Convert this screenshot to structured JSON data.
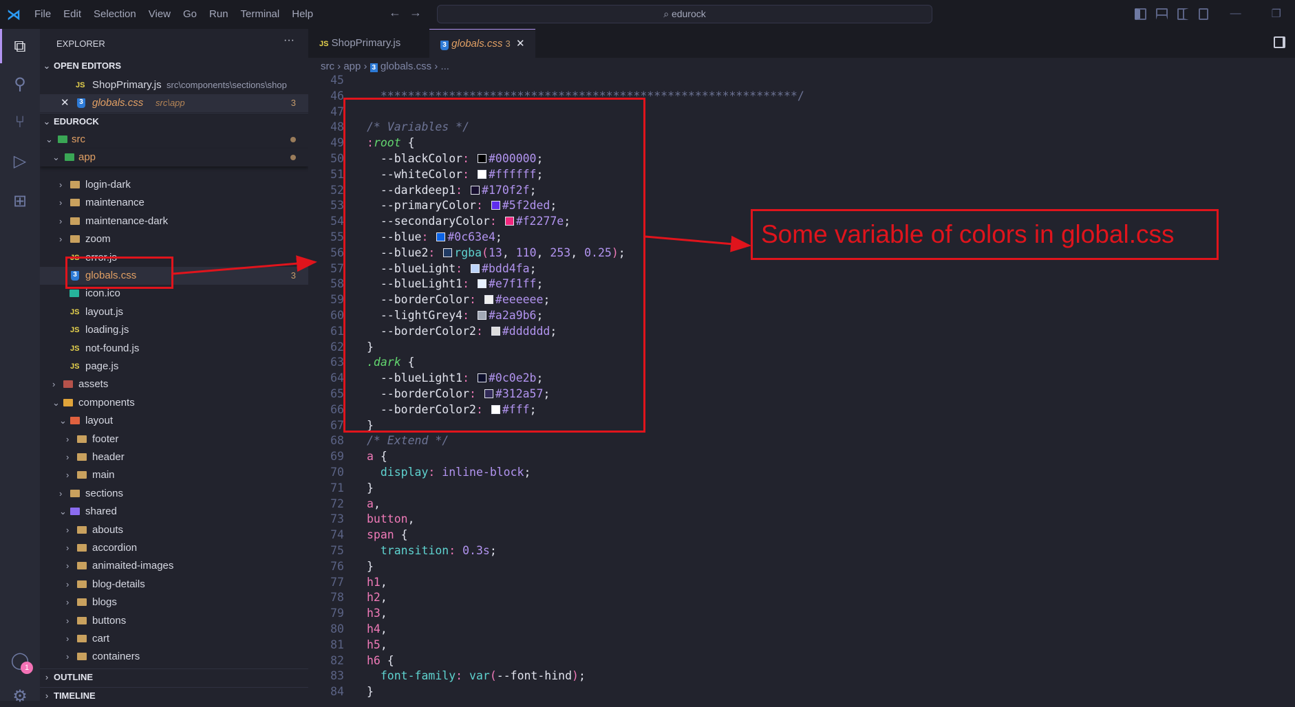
{
  "titlebar": {
    "menu": [
      "File",
      "Edit",
      "Selection",
      "View",
      "Go",
      "Run",
      "Terminal",
      "Help"
    ],
    "search": "edurock"
  },
  "explorer": {
    "title": "EXPLORER",
    "more": "···",
    "open_editors": "OPEN EDITORS",
    "project": "EDUROCK",
    "outline": "OUTLINE",
    "timeline": "TIMELINE",
    "open_files": [
      {
        "name": "ShopPrimary.js",
        "path": "src\\components\\sections\\shop",
        "type": "js"
      },
      {
        "name": "globals.css",
        "path": "src\\app",
        "type": "css",
        "count": "3",
        "close": "✕"
      }
    ],
    "src": "src",
    "app": "app",
    "tree": [
      {
        "label": "login-dark",
        "lvl": 2,
        "type": "folder"
      },
      {
        "label": "maintenance",
        "lvl": 2,
        "type": "folder"
      },
      {
        "label": "maintenance-dark",
        "lvl": 2,
        "type": "folder"
      },
      {
        "label": "zoom",
        "lvl": 2,
        "type": "folder"
      },
      {
        "label": "error.js",
        "lvl": 2,
        "type": "js"
      },
      {
        "label": "globals.css",
        "lvl": 2,
        "type": "css",
        "count": "3",
        "selected": true
      },
      {
        "label": "icon.ico",
        "lvl": 2,
        "type": "img"
      },
      {
        "label": "layout.js",
        "lvl": 2,
        "type": "js"
      },
      {
        "label": "loading.js",
        "lvl": 2,
        "type": "js"
      },
      {
        "label": "not-found.js",
        "lvl": 2,
        "type": "js"
      },
      {
        "label": "page.js",
        "lvl": 2,
        "type": "js"
      },
      {
        "label": "assets",
        "lvl": 1,
        "type": "folder-special",
        "color": "#b5524b"
      },
      {
        "label": "components",
        "lvl": 1,
        "type": "folder-open",
        "color": "#e0a43a"
      },
      {
        "label": "layout",
        "lvl": 2,
        "type": "folder-open",
        "color": "#e0613f"
      },
      {
        "label": "footer",
        "lvl": 3,
        "type": "folder"
      },
      {
        "label": "header",
        "lvl": 3,
        "type": "folder"
      },
      {
        "label": "main",
        "lvl": 3,
        "type": "folder"
      },
      {
        "label": "sections",
        "lvl": 2,
        "type": "folder"
      },
      {
        "label": "shared",
        "lvl": 2,
        "type": "folder-open",
        "color": "#8b6cf0"
      },
      {
        "label": "abouts",
        "lvl": 3,
        "type": "folder"
      },
      {
        "label": "accordion",
        "lvl": 3,
        "type": "folder"
      },
      {
        "label": "animaited-images",
        "lvl": 3,
        "type": "folder"
      },
      {
        "label": "blog-details",
        "lvl": 3,
        "type": "folder"
      },
      {
        "label": "blogs",
        "lvl": 3,
        "type": "folder"
      },
      {
        "label": "buttons",
        "lvl": 3,
        "type": "folder"
      },
      {
        "label": "cart",
        "lvl": 3,
        "type": "folder"
      },
      {
        "label": "containers",
        "lvl": 3,
        "type": "folder"
      }
    ]
  },
  "tabs": [
    {
      "label": "ShopPrimary.js",
      "type": "js"
    },
    {
      "label": "globals.css",
      "type": "css",
      "count": "3",
      "close": "✕",
      "active": true
    }
  ],
  "breadcrumb": [
    "src",
    "app",
    "globals.css",
    "..."
  ],
  "accounts_badge": "1",
  "code": [
    {
      "n": 45,
      "t": []
    },
    {
      "n": 46,
      "t": [
        [
          "stars",
          "  *************************************************************/"
        ]
      ]
    },
    {
      "n": 47,
      "t": []
    },
    {
      "n": 48,
      "t": [
        [
          "c",
          "/* Variables */"
        ]
      ]
    },
    {
      "n": 49,
      "t": [
        [
          "colon",
          ":"
        ],
        [
          "green",
          "root"
        ],
        [
          "punc",
          " {"
        ]
      ]
    },
    {
      "n": 50,
      "t": [
        [
          "prop",
          "  --blackColor"
        ],
        [
          "colon",
          ": "
        ],
        [
          "sw",
          "#000000"
        ],
        [
          "val",
          "#000000"
        ],
        [
          "punc",
          ";"
        ]
      ]
    },
    {
      "n": 51,
      "t": [
        [
          "prop",
          "  --whiteColor"
        ],
        [
          "colon",
          ": "
        ],
        [
          "sw",
          "#ffffff"
        ],
        [
          "val",
          "#ffffff"
        ],
        [
          "punc",
          ";"
        ]
      ]
    },
    {
      "n": 52,
      "t": [
        [
          "prop",
          "  --darkdeep1"
        ],
        [
          "colon",
          ": "
        ],
        [
          "sw",
          "#170f2f"
        ],
        [
          "val",
          "#170f2f"
        ],
        [
          "punc",
          ";"
        ]
      ]
    },
    {
      "n": 53,
      "t": [
        [
          "prop",
          "  --primaryColor"
        ],
        [
          "colon",
          ": "
        ],
        [
          "sw",
          "#5f2ded"
        ],
        [
          "val",
          "#5f2ded"
        ],
        [
          "punc",
          ";"
        ]
      ]
    },
    {
      "n": 54,
      "t": [
        [
          "prop",
          "  --secondaryColor"
        ],
        [
          "colon",
          ": "
        ],
        [
          "sw",
          "#f2277e"
        ],
        [
          "val",
          "#f2277e"
        ],
        [
          "punc",
          ";"
        ]
      ]
    },
    {
      "n": 55,
      "t": [
        [
          "prop",
          "  --blue"
        ],
        [
          "colon",
          ": "
        ],
        [
          "sw",
          "#0c63e4"
        ],
        [
          "val",
          "#0c63e4"
        ],
        [
          "punc",
          ";"
        ]
      ]
    },
    {
      "n": 56,
      "t": [
        [
          "prop",
          "  --blue2"
        ],
        [
          "colon",
          ": "
        ],
        [
          "sw",
          "#1f3a63"
        ],
        [
          "fn",
          "rgba"
        ],
        [
          "paren",
          "("
        ],
        [
          "val",
          "13"
        ],
        [
          "punc",
          ", "
        ],
        [
          "val",
          "110"
        ],
        [
          "punc",
          ", "
        ],
        [
          "val",
          "253"
        ],
        [
          "punc",
          ", "
        ],
        [
          "val",
          "0.25"
        ],
        [
          "paren",
          ")"
        ],
        [
          "punc",
          ";"
        ]
      ]
    },
    {
      "n": 57,
      "t": [
        [
          "prop",
          "  --blueLight"
        ],
        [
          "colon",
          ": "
        ],
        [
          "sw",
          "#bdd4fa"
        ],
        [
          "val",
          "#bdd4fa"
        ],
        [
          "punc",
          ";"
        ]
      ]
    },
    {
      "n": 58,
      "t": [
        [
          "prop",
          "  --blueLight1"
        ],
        [
          "colon",
          ": "
        ],
        [
          "sw",
          "#e7f1ff"
        ],
        [
          "val",
          "#e7f1ff"
        ],
        [
          "punc",
          ";"
        ]
      ]
    },
    {
      "n": 59,
      "t": [
        [
          "prop",
          "  --borderColor"
        ],
        [
          "colon",
          ": "
        ],
        [
          "sw",
          "#eeeeee"
        ],
        [
          "val",
          "#eeeeee"
        ],
        [
          "punc",
          ";"
        ]
      ]
    },
    {
      "n": 60,
      "t": [
        [
          "prop",
          "  --lightGrey4"
        ],
        [
          "colon",
          ": "
        ],
        [
          "sw",
          "#a2a9b6"
        ],
        [
          "val",
          "#a2a9b6"
        ],
        [
          "punc",
          ";"
        ]
      ]
    },
    {
      "n": 61,
      "t": [
        [
          "prop",
          "  --borderColor2"
        ],
        [
          "colon",
          ": "
        ],
        [
          "sw",
          "#dddddd"
        ],
        [
          "val",
          "#dddddd"
        ],
        [
          "punc",
          ";"
        ]
      ]
    },
    {
      "n": 62,
      "t": [
        [
          "punc",
          "}"
        ]
      ]
    },
    {
      "n": 63,
      "t": [
        [
          "green",
          ".dark"
        ],
        [
          "punc",
          " {"
        ]
      ]
    },
    {
      "n": 64,
      "t": [
        [
          "prop",
          "  --blueLight1"
        ],
        [
          "colon",
          ": "
        ],
        [
          "sw",
          "#0c0e2b"
        ],
        [
          "val",
          "#0c0e2b"
        ],
        [
          "punc",
          ";"
        ]
      ]
    },
    {
      "n": 65,
      "t": [
        [
          "prop",
          "  --borderColor"
        ],
        [
          "colon",
          ": "
        ],
        [
          "sw",
          "#312a57"
        ],
        [
          "val",
          "#312a57"
        ],
        [
          "punc",
          ";"
        ]
      ]
    },
    {
      "n": 66,
      "t": [
        [
          "prop",
          "  --borderColor2"
        ],
        [
          "colon",
          ": "
        ],
        [
          "sw",
          "#ffffff"
        ],
        [
          "val",
          "#fff"
        ],
        [
          "punc",
          ";"
        ]
      ]
    },
    {
      "n": 67,
      "t": [
        [
          "punc",
          "}"
        ]
      ]
    },
    {
      "n": 68,
      "t": [
        [
          "c",
          "/* Extend */"
        ]
      ]
    },
    {
      "n": 69,
      "t": [
        [
          "sel",
          "a"
        ],
        [
          "punc",
          " {"
        ]
      ]
    },
    {
      "n": 70,
      "t": [
        [
          "sprop",
          "  display"
        ],
        [
          "colon",
          ": "
        ],
        [
          "val",
          "inline-block"
        ],
        [
          "punc",
          ";"
        ]
      ]
    },
    {
      "n": 71,
      "t": [
        [
          "punc",
          "}"
        ]
      ]
    },
    {
      "n": 72,
      "t": [
        [
          "sel",
          "a"
        ],
        [
          "punc",
          ","
        ]
      ]
    },
    {
      "n": 73,
      "t": [
        [
          "sel",
          "button"
        ],
        [
          "punc",
          ","
        ]
      ]
    },
    {
      "n": 74,
      "t": [
        [
          "sel",
          "span"
        ],
        [
          "punc",
          " {"
        ]
      ]
    },
    {
      "n": 75,
      "t": [
        [
          "sprop",
          "  transition"
        ],
        [
          "colon",
          ": "
        ],
        [
          "val",
          "0.3s"
        ],
        [
          "punc",
          ";"
        ]
      ]
    },
    {
      "n": 76,
      "t": [
        [
          "punc",
          "}"
        ]
      ]
    },
    {
      "n": 77,
      "t": [
        [
          "sel",
          "h1"
        ],
        [
          "punc",
          ","
        ]
      ]
    },
    {
      "n": 78,
      "t": [
        [
          "sel",
          "h2"
        ],
        [
          "punc",
          ","
        ]
      ]
    },
    {
      "n": 79,
      "t": [
        [
          "sel",
          "h3"
        ],
        [
          "punc",
          ","
        ]
      ]
    },
    {
      "n": 80,
      "t": [
        [
          "sel",
          "h4"
        ],
        [
          "punc",
          ","
        ]
      ]
    },
    {
      "n": 81,
      "t": [
        [
          "sel",
          "h5"
        ],
        [
          "punc",
          ","
        ]
      ]
    },
    {
      "n": 82,
      "t": [
        [
          "sel",
          "h6"
        ],
        [
          "punc",
          " {"
        ]
      ]
    },
    {
      "n": 83,
      "t": [
        [
          "sprop",
          "  font-family"
        ],
        [
          "colon",
          ": "
        ],
        [
          "fn",
          "var"
        ],
        [
          "paren",
          "("
        ],
        [
          "punc",
          "--font-hind"
        ],
        [
          "paren",
          ")"
        ],
        [
          "punc",
          ";"
        ]
      ]
    },
    {
      "n": 84,
      "t": [
        [
          "punc",
          "}"
        ]
      ]
    }
  ],
  "annotation": {
    "text": "Some variable of colors in global.css",
    "color": "#e0141c"
  }
}
